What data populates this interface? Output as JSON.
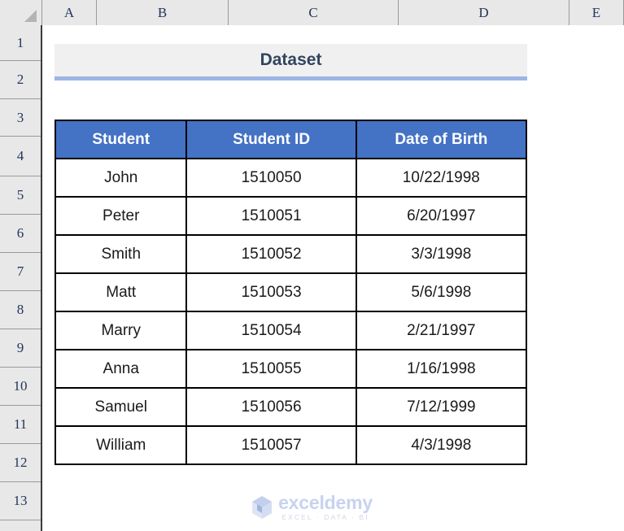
{
  "app": {
    "type": "spreadsheet",
    "corner_icon": "select-all-triangle-icon"
  },
  "grid": {
    "column_headers": [
      "A",
      "B",
      "C",
      "D",
      "E"
    ],
    "row_headers": [
      "1",
      "2",
      "3",
      "4",
      "5",
      "6",
      "7",
      "8",
      "9",
      "10",
      "11",
      "12",
      "13"
    ]
  },
  "title_block": {
    "text": "Dataset",
    "fill_color": "#f0f0f0",
    "underline_color": "#9cb5e4",
    "text_color": "#31455f"
  },
  "table": {
    "header_fill": "#4472C4",
    "header_text_color": "#ffffff",
    "border_color": "#000000",
    "columns": [
      "Student",
      "Student ID",
      "Date of Birth"
    ],
    "rows": [
      {
        "student": "John",
        "student_id": "1510050",
        "dob": "10/22/1998"
      },
      {
        "student": "Peter",
        "student_id": "1510051",
        "dob": "6/20/1997"
      },
      {
        "student": "Smith",
        "student_id": "1510052",
        "dob": "3/3/1998"
      },
      {
        "student": "Matt",
        "student_id": "1510053",
        "dob": "5/6/1998"
      },
      {
        "student": "Marry",
        "student_id": "1510054",
        "dob": "2/21/1997"
      },
      {
        "student": "Anna",
        "student_id": "1510055",
        "dob": "1/16/1998"
      },
      {
        "student": "Samuel",
        "student_id": "1510056",
        "dob": "7/12/1999"
      },
      {
        "student": "William",
        "student_id": "1510057",
        "dob": "4/3/1998"
      }
    ]
  },
  "watermark": {
    "name": "exceldemy",
    "tagline": "EXCEL · DATA · BI",
    "icon": "exceldemy-cube-logo-icon",
    "name_color": "#c7d3ef",
    "tagline_color": "#d2d8e6"
  }
}
